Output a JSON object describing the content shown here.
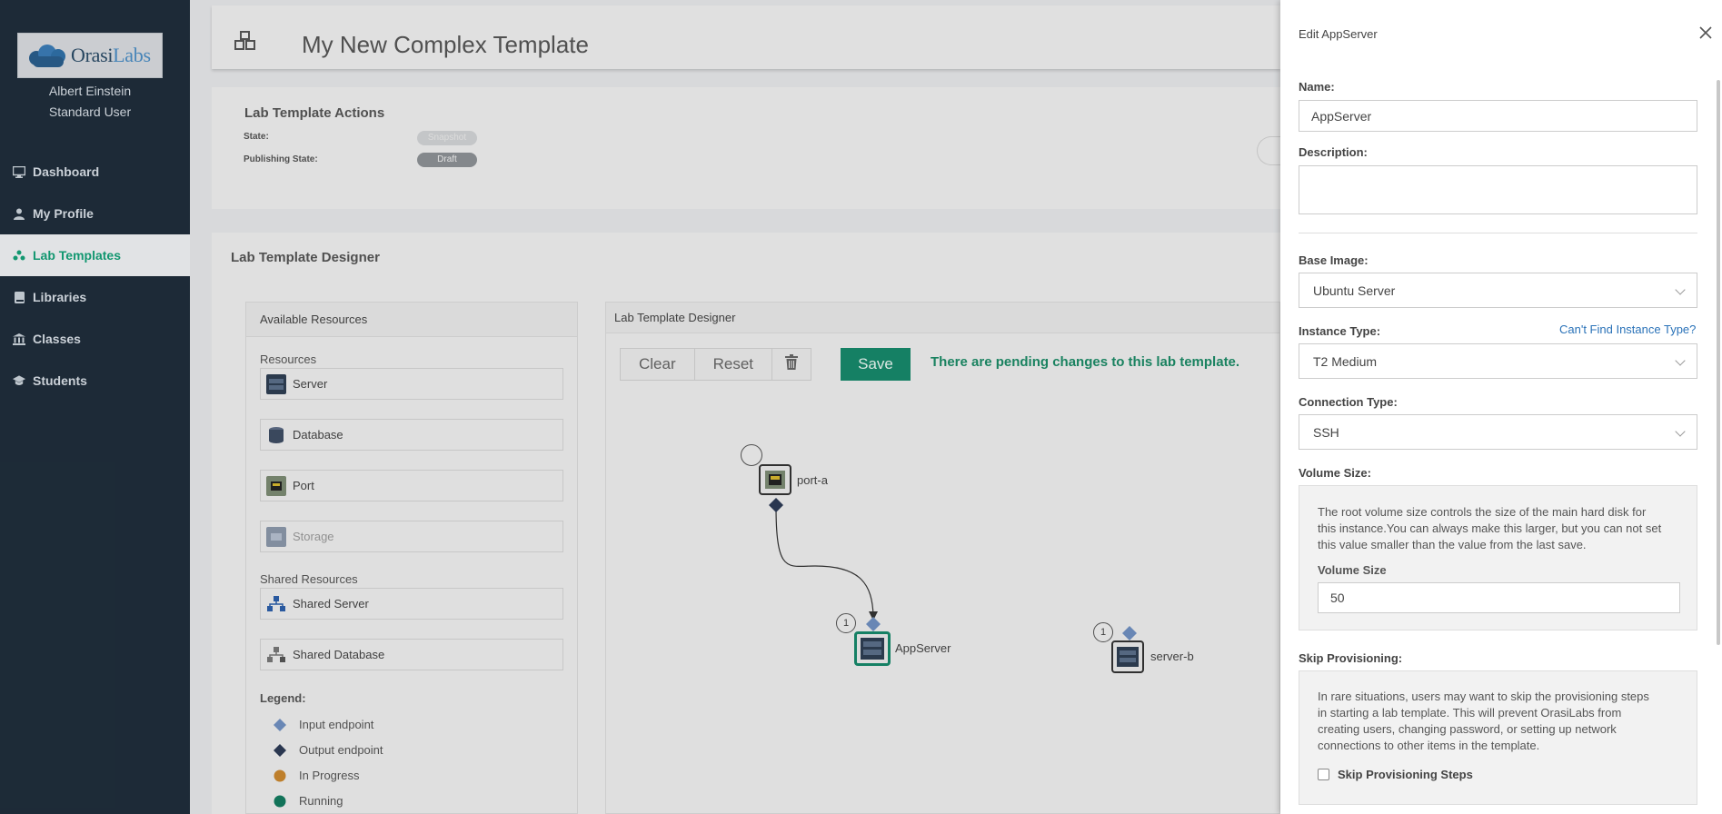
{
  "sidebar": {
    "logo_text_1": "Orasi",
    "logo_text_2": "Labs",
    "user_name": "Albert Einstein",
    "user_role": "Standard User",
    "items": [
      {
        "label": "Dashboard",
        "icon": "monitor-icon"
      },
      {
        "label": "My Profile",
        "icon": "user-icon"
      },
      {
        "label": "Lab Templates",
        "icon": "flask-icon",
        "active": true
      },
      {
        "label": "Libraries",
        "icon": "book-icon"
      },
      {
        "label": "Classes",
        "icon": "institution-icon"
      },
      {
        "label": "Students",
        "icon": "graduation-cap-icon"
      }
    ]
  },
  "header": {
    "title": "My New Complex Template"
  },
  "actions": {
    "title": "Lab Template Actions",
    "state_label": "State:",
    "state_value": "Snapshot",
    "publishing_label": "Publishing State:",
    "publishing_value": "Draft"
  },
  "designer": {
    "title": "Lab Template Designer",
    "resources_panel": {
      "title": "Available Resources",
      "resources_label": "Resources",
      "resources": [
        "Server",
        "Database",
        "Port",
        "Storage"
      ],
      "shared_label": "Shared Resources",
      "shared": [
        "Shared Server",
        "Shared Database"
      ],
      "legend_title": "Legend:",
      "legend": [
        "Input endpoint",
        "Output endpoint",
        "In Progress",
        "Running"
      ]
    },
    "canvas": {
      "title": "Lab Template Designer",
      "clear": "Clear",
      "reset": "Reset",
      "save": "Save",
      "pending": "There are pending changes to this lab template.",
      "nodes": {
        "port": "port-a",
        "app": "AppServer",
        "server": "server-b",
        "app_count": "1",
        "server_count": "1"
      }
    }
  },
  "edit_panel": {
    "title": "Edit AppServer",
    "name_label": "Name:",
    "name_value": "AppServer",
    "description_label": "Description:",
    "base_image_label": "Base Image:",
    "base_image_value": "Ubuntu Server",
    "instance_type_label": "Instance Type:",
    "instance_type_value": "T2 Medium",
    "instance_help_link": "Can't Find Instance Type?",
    "connection_type_label": "Connection Type:",
    "connection_type_value": "SSH",
    "volume_label": "Volume Size:",
    "volume_info_1": "The root volume size controls the size of the main hard disk for",
    "volume_info_2": "this instance.You can always make this larger, but you can not set",
    "volume_info_3": "this value smaller than the value from the last save.",
    "volume_size_label": "Volume Size",
    "volume_size_value": "50",
    "skip_label": "Skip Provisioning:",
    "skip_info_1": "In rare situations, users may want to skip the provisioning steps",
    "skip_info_2": "in starting a lab template. This will prevent OrasiLabs from",
    "skip_info_3": "creating users, changing password, or setting up network",
    "skip_info_4": "connections to other items in the template.",
    "skip_checkbox_label": "Skip Provisioning Steps"
  },
  "colors": {
    "sidebar_bg": "#1f2d3a",
    "accent_green": "#17876a",
    "link_blue": "#2a72b8"
  }
}
